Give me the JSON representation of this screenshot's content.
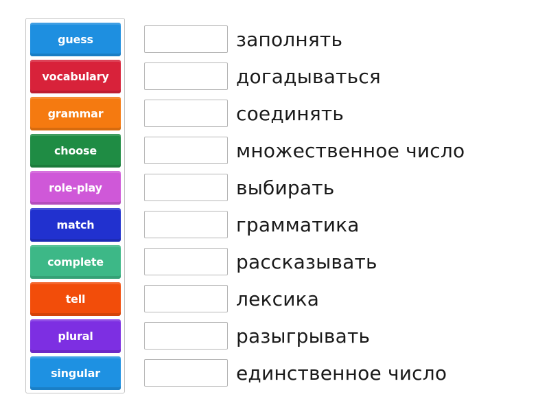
{
  "tiles": [
    {
      "label": "guess",
      "color": "#1e8fe0"
    },
    {
      "label": "vocabulary",
      "color": "#d8223a"
    },
    {
      "label": "grammar",
      "color": "#f57a10"
    },
    {
      "label": "choose",
      "color": "#1f8c44"
    },
    {
      "label": "role-play",
      "color": "#cf58d8"
    },
    {
      "label": "match",
      "color": "#2131cf"
    },
    {
      "label": "complete",
      "color": "#3db887"
    },
    {
      "label": "tell",
      "color": "#f24d0a"
    },
    {
      "label": "plural",
      "color": "#7d2fe2"
    },
    {
      "label": "singular",
      "color": "#1e91e2"
    }
  ],
  "targets": [
    {
      "text": "заполнять",
      "answer": ""
    },
    {
      "text": "догадываться",
      "answer": ""
    },
    {
      "text": "соединять",
      "answer": ""
    },
    {
      "text": "множественное число",
      "answer": ""
    },
    {
      "text": "выбирать",
      "answer": ""
    },
    {
      "text": "грамматика",
      "answer": ""
    },
    {
      "text": "рассказывать",
      "answer": ""
    },
    {
      "text": "лексика",
      "answer": ""
    },
    {
      "text": "разыгрывать",
      "answer": ""
    },
    {
      "text": "единственное число",
      "answer": ""
    }
  ]
}
